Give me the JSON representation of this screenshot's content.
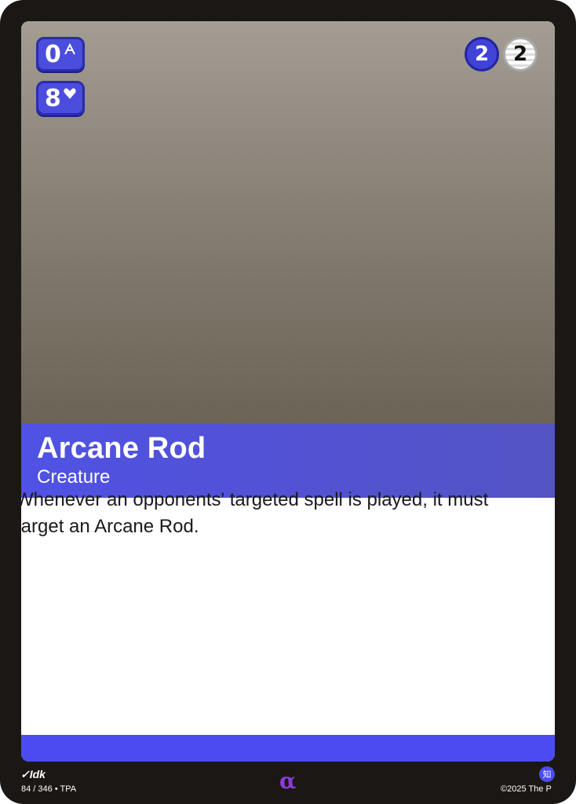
{
  "card": {
    "name": "Arcane Rod",
    "type": "Creature",
    "rules_text": "Whenever an opponents' targeted spell is played, it must target an Arcane Rod.",
    "stats": {
      "speed": {
        "value": "0",
        "icon": "speed-icon"
      },
      "health": {
        "value": "8",
        "icon": "heart-icon"
      }
    },
    "cost": {
      "colored": "2",
      "generic": "2"
    }
  },
  "footer": {
    "artist": "Idk",
    "artist_icon": "brush-icon",
    "set_info": "84 / 346 • TPA",
    "rarity_symbol": "α",
    "knowledge_glyph": "知",
    "copyright": "©2025 The P"
  },
  "colors": {
    "accent": "#4a4bf0",
    "rarity": "#8c3bd6",
    "border": "#1a1714"
  }
}
